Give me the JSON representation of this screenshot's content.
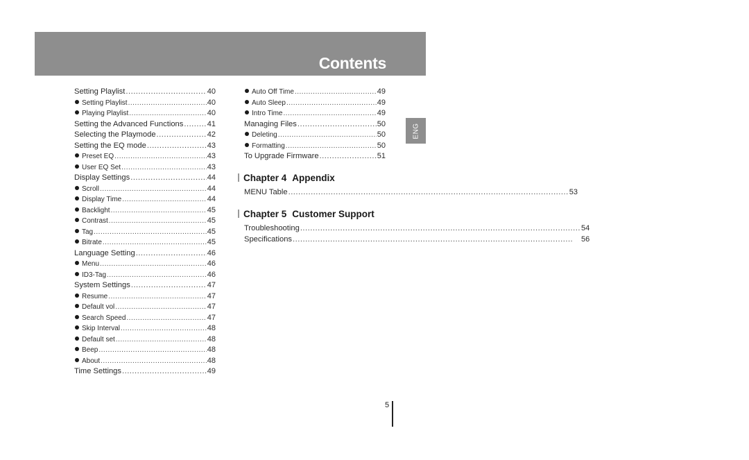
{
  "header": {
    "title": "Contents"
  },
  "side_tab": {
    "label": "ENG"
  },
  "left_column": [
    {
      "label": "Setting Playlist",
      "page": "40",
      "level": "main"
    },
    {
      "label": "Setting Playlist",
      "page": "40",
      "level": "sub"
    },
    {
      "label": "Playing Playlist",
      "page": "40",
      "level": "sub"
    },
    {
      "label": "Setting the Advanced Functions",
      "page": "41",
      "level": "main"
    },
    {
      "label": "Selecting the Playmode",
      "page": "42",
      "level": "main"
    },
    {
      "label": "Setting the EQ mode",
      "page": "43",
      "level": "main"
    },
    {
      "label": "Preset EQ",
      "page": "43",
      "level": "sub"
    },
    {
      "label": "User EQ Set",
      "page": "43",
      "level": "sub"
    },
    {
      "label": "Display Settings",
      "page": "44",
      "level": "main"
    },
    {
      "label": "Scroll",
      "page": "44",
      "level": "sub"
    },
    {
      "label": "Display Time",
      "page": "44",
      "level": "sub"
    },
    {
      "label": "Backlight",
      "page": "45",
      "level": "sub"
    },
    {
      "label": "Contrast",
      "page": "45",
      "level": "sub"
    },
    {
      "label": "Tag",
      "page": "45",
      "level": "sub"
    },
    {
      "label": "Bitrate",
      "page": "45",
      "level": "sub"
    },
    {
      "label": "Language Setting",
      "page": "46",
      "level": "main"
    },
    {
      "label": "Menu",
      "page": "46",
      "level": "sub"
    },
    {
      "label": "ID3-Tag",
      "page": "46",
      "level": "sub"
    },
    {
      "label": "System Settings",
      "page": "47",
      "level": "main"
    },
    {
      "label": "Resume",
      "page": "47",
      "level": "sub"
    },
    {
      "label": "Default vol",
      "page": "47",
      "level": "sub"
    },
    {
      "label": "Search Speed",
      "page": "47",
      "level": "sub"
    },
    {
      "label": "Skip Interval",
      "page": "48",
      "level": "sub"
    },
    {
      "label": "Default set",
      "page": "48",
      "level": "sub"
    },
    {
      "label": "Beep",
      "page": "48",
      "level": "sub"
    },
    {
      "label": "About",
      "page": "48",
      "level": "sub"
    },
    {
      "label": "Time Settings",
      "page": "49",
      "level": "main"
    }
  ],
  "right_column": [
    {
      "label": "Auto Off Time",
      "page": "49",
      "level": "sub"
    },
    {
      "label": "Auto Sleep",
      "page": "49",
      "level": "sub"
    },
    {
      "label": "Intro Time",
      "page": "49",
      "level": "sub"
    },
    {
      "label": "Managing Files",
      "page": "50",
      "level": "main"
    },
    {
      "label": "Deleting",
      "page": "50",
      "level": "sub"
    },
    {
      "label": "Formatting",
      "page": "50",
      "level": "sub"
    },
    {
      "label": "To Upgrade Firmware",
      "page": "51",
      "level": "main"
    }
  ],
  "chapters": [
    {
      "number": "Chapter 4",
      "title": "Appendix",
      "entries": [
        {
          "label": "MENU Table",
          "page": "53",
          "level": "main"
        }
      ]
    },
    {
      "number": "Chapter 5",
      "title": "Customer Support",
      "entries": [
        {
          "label": "Troubleshooting",
          "page": "54",
          "level": "main"
        },
        {
          "label": "Specifications",
          "page": "56",
          "level": "main"
        }
      ]
    }
  ],
  "footer": {
    "page_number": "5"
  },
  "colors": {
    "header_bg": "#8e8e8e",
    "header_text": "#ffffff",
    "body_text": "#2a2a2a"
  }
}
